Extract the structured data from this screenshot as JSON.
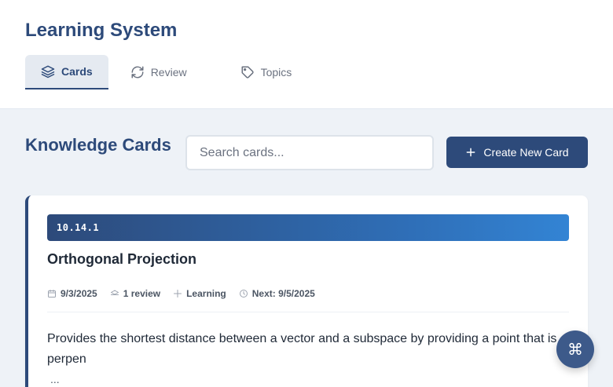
{
  "app": {
    "title": "Learning System"
  },
  "tabs": [
    {
      "label": "Cards",
      "icon": "layers-icon",
      "active": true
    },
    {
      "label": "Review",
      "icon": "refresh-icon",
      "active": false
    },
    {
      "label": "Topics",
      "icon": "tag-icon",
      "active": false
    }
  ],
  "main": {
    "section_title": "Knowledge Cards",
    "search_placeholder": "Search cards...",
    "create_button_label": "Create New Card"
  },
  "card": {
    "id": "10.14.1",
    "title": "Orthogonal Projection",
    "meta": {
      "date": "9/3/2025",
      "reviews": "1 review",
      "status": "Learning",
      "next": "Next: 9/5/2025"
    },
    "description": "Provides the shortest distance between a vector and a subspace by providing a point that is perpen",
    "more": "..."
  },
  "fab": {
    "label": "⌘"
  },
  "colors": {
    "primary": "#2d4a7a",
    "accent_gradient_end": "#3384d4",
    "background": "#eef2f7"
  }
}
